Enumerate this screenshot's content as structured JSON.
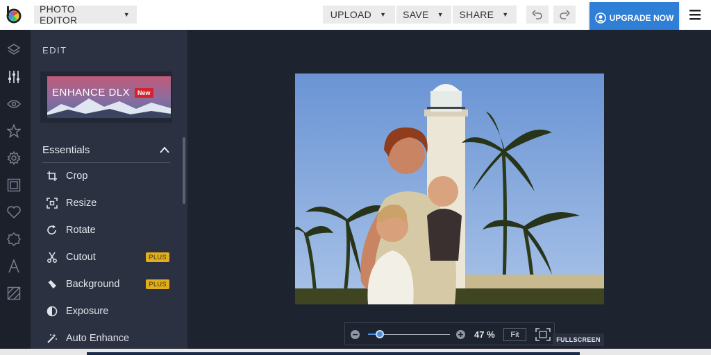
{
  "topbar": {
    "app_menu": "PHOTO EDITOR",
    "upload": "UPLOAD",
    "save": "SAVE",
    "share": "SHARE",
    "upgrade": "UPGRADE NOW"
  },
  "rail": {
    "icons": [
      "layers-icon",
      "sliders-icon",
      "eye-icon",
      "star-icon",
      "gear-icon",
      "frame-icon",
      "heart-icon",
      "badge-icon",
      "text-icon",
      "texture-icon"
    ]
  },
  "panel": {
    "title": "EDIT",
    "banner": {
      "label": "ENHANCE DLX",
      "badge": "New"
    },
    "section": "Essentials",
    "tools": [
      {
        "label": "Crop",
        "icon": "crop-icon"
      },
      {
        "label": "Resize",
        "icon": "resize-icon"
      },
      {
        "label": "Rotate",
        "icon": "rotate-icon"
      },
      {
        "label": "Cutout",
        "icon": "scissors-icon",
        "badge": "PLUS"
      },
      {
        "label": "Background",
        "icon": "eraser-icon",
        "badge": "PLUS"
      },
      {
        "label": "Exposure",
        "icon": "exposure-icon"
      },
      {
        "label": "Auto Enhance",
        "icon": "magic-wand-icon"
      }
    ]
  },
  "zoom": {
    "value": "47 %",
    "level": 0.14,
    "fit": "Fit",
    "fullscreen": "FULLSCREEN"
  },
  "colors": {
    "accent": "#2f7fd6",
    "panel": "#2b3140",
    "canvas": "#1e2330",
    "plus_badge": "#e1ae1f"
  }
}
